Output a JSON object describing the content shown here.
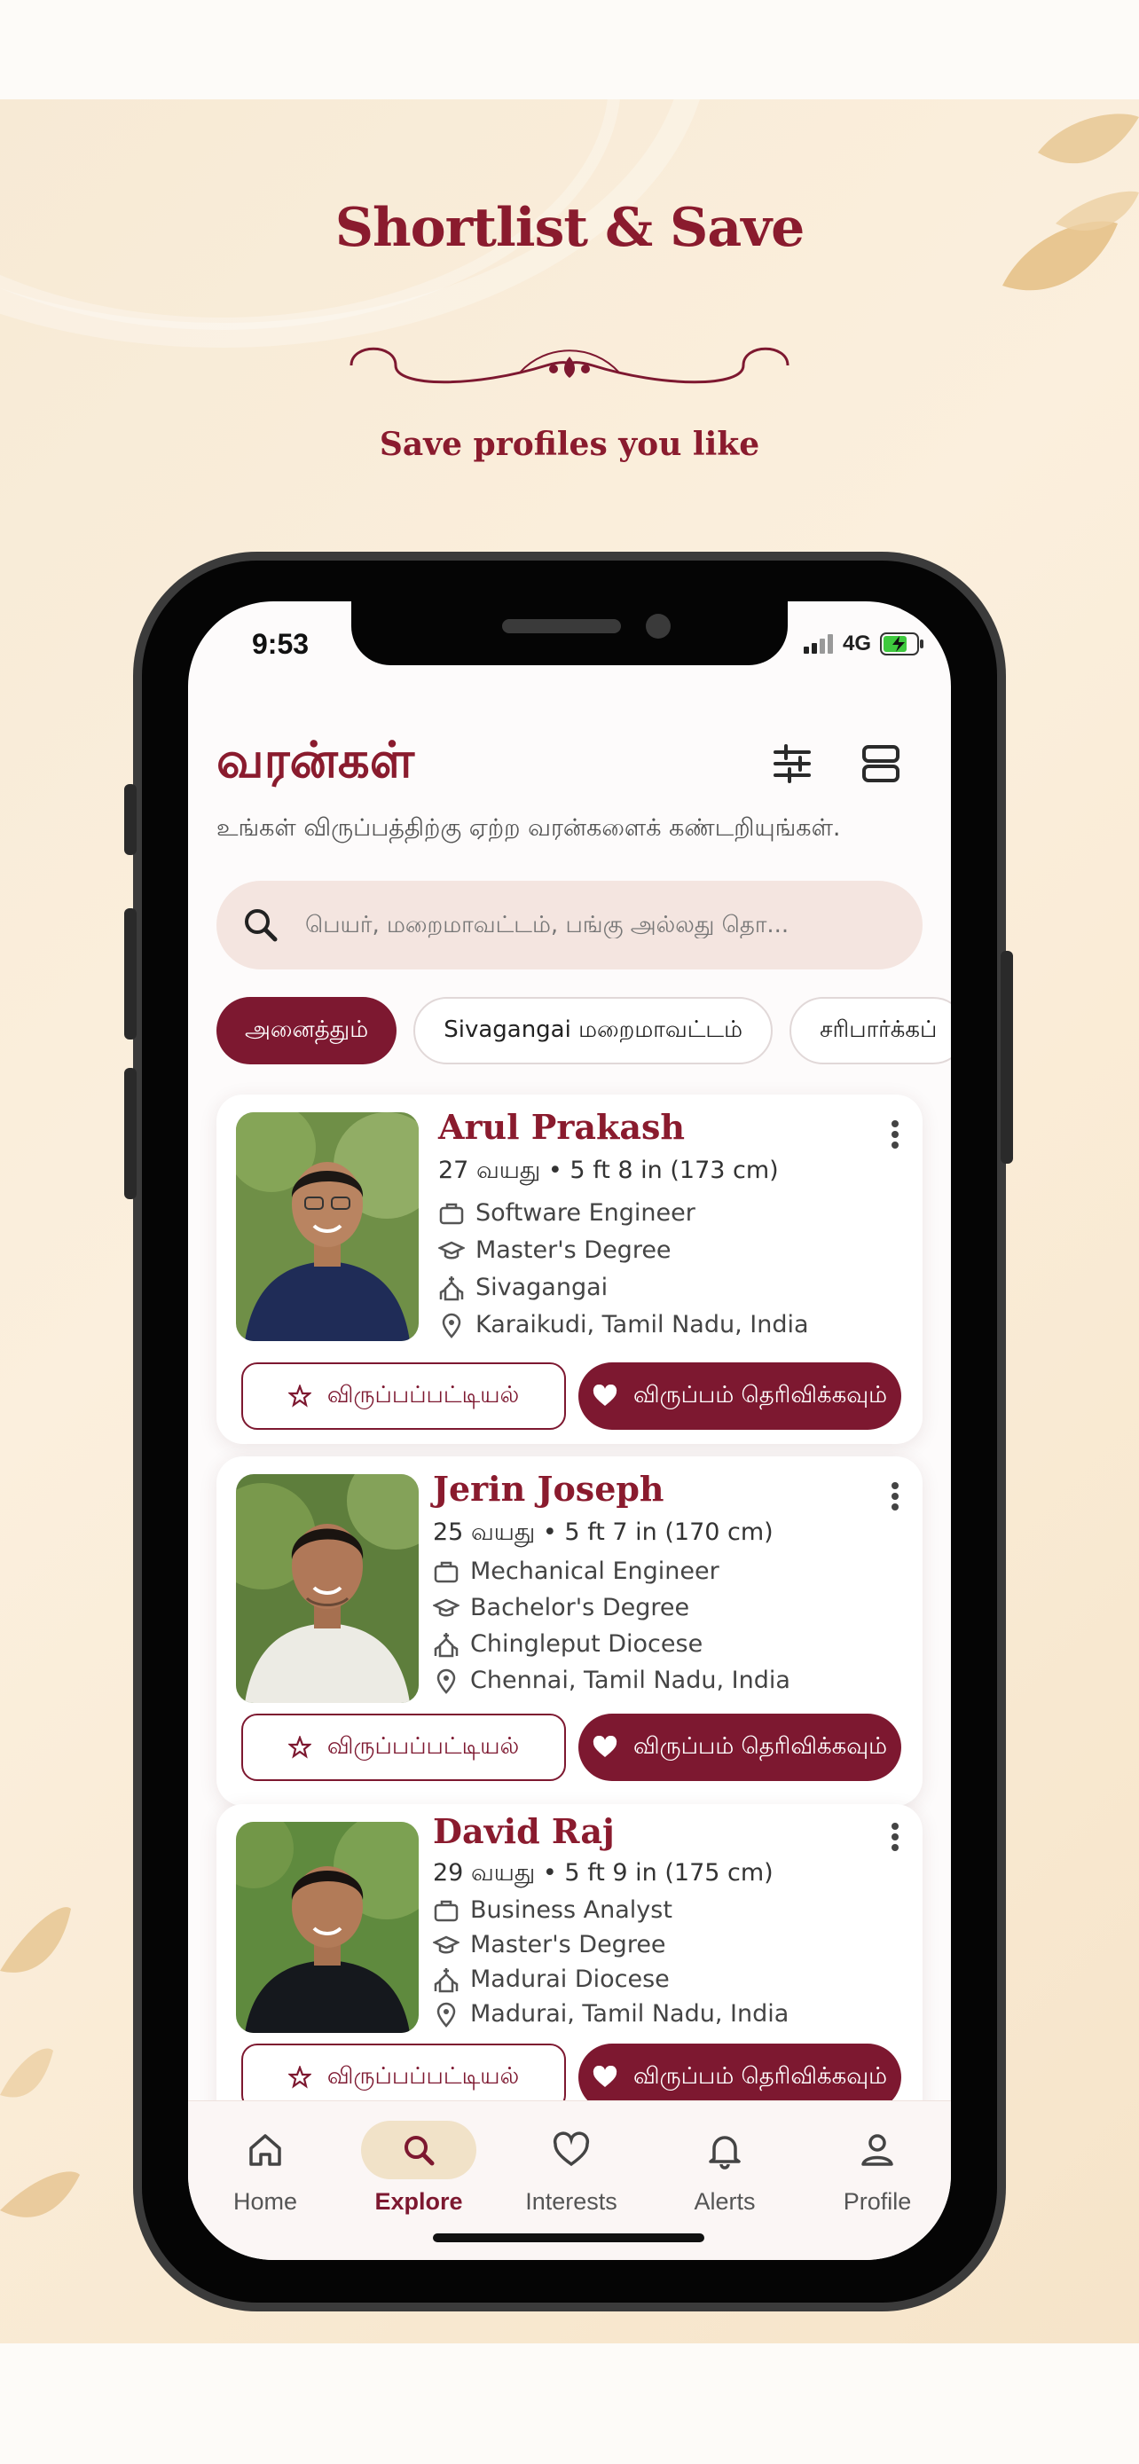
{
  "poster": {
    "headline": "Shortlist & Save",
    "subhead": "Save profiles you like"
  },
  "status_bar": {
    "time": "9:53",
    "network": "4G"
  },
  "header": {
    "title": "வரன்கள்",
    "subtitle": "உங்கள் விருப்பத்திற்கு ஏற்ற வரன்களைக் கண்டறியுங்கள்."
  },
  "search": {
    "placeholder": "பெயர், மறைமாவட்டம், பங்கு அல்லது தொ..."
  },
  "filters": [
    "அனைத்தும்",
    "Sivagangai மறைமாவட்டம்",
    "சரிபார்க்கப்"
  ],
  "profiles": [
    {
      "name": "Arul Prakash",
      "meta": "27 வயது • 5 ft 8 in (173 cm)",
      "job": "Software Engineer",
      "education": "Master's Degree",
      "diocese": "Sivagangai",
      "location": "Karaikudi, Tamil Nadu, India",
      "shirt_color": "#1f2c57"
    },
    {
      "name": "Jerin Joseph",
      "meta": "25 வயது • 5 ft 7 in (170 cm)",
      "job": "Mechanical Engineer",
      "education": "Bachelor's Degree",
      "diocese": "Chingleput Diocese",
      "location": "Chennai, Tamil Nadu, India",
      "shirt_color": "#ecebe4"
    },
    {
      "name": "David Raj",
      "meta": "29 வயது • 5 ft 9 in (175 cm)",
      "job": "Business Analyst",
      "education": "Master's Degree",
      "diocese": "Madurai Diocese",
      "location": "Madurai, Tamil Nadu, India",
      "shirt_color": "#15181d"
    }
  ],
  "buttons": {
    "shortlist": "விருப்பப்பட்டியல்",
    "interest": "விருப்பம் தெரிவிக்கவும்"
  },
  "nav": [
    {
      "label": "Home",
      "icon": "home-icon"
    },
    {
      "label": "Explore",
      "icon": "search-icon"
    },
    {
      "label": "Interests",
      "icon": "heart-icon"
    },
    {
      "label": "Alerts",
      "icon": "bell-icon"
    },
    {
      "label": "Profile",
      "icon": "user-icon"
    }
  ],
  "colors": {
    "brand": "#7d1830",
    "title": "#8a1b2e",
    "active_nav_bg": "#f1e2c8"
  }
}
